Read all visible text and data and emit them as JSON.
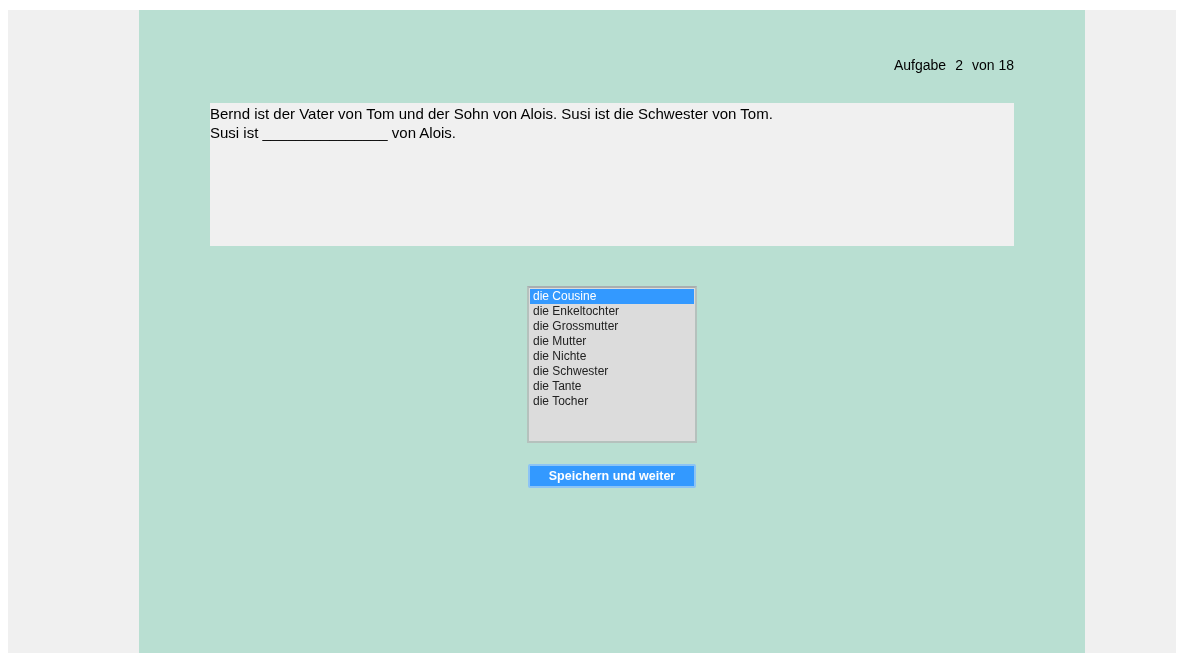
{
  "counter": {
    "label": "Aufgabe",
    "current": "2",
    "total": "von 18"
  },
  "question": {
    "lines": [
      "Bernd ist der Vater von Tom und der Sohn von Alois. Susi ist die Schwester von Tom.",
      "Susi ist _______________ von Alois."
    ]
  },
  "options": [
    {
      "label": "die Cousine",
      "selected": true
    },
    {
      "label": "die Enkeltochter",
      "selected": false
    },
    {
      "label": "die Grossmutter",
      "selected": false
    },
    {
      "label": "die Mutter",
      "selected": false
    },
    {
      "label": "die Nichte",
      "selected": false
    },
    {
      "label": "die Schwester",
      "selected": false
    },
    {
      "label": "die Tante",
      "selected": false
    },
    {
      "label": "die Tocher",
      "selected": false
    }
  ],
  "button": "Speichern und weiter"
}
